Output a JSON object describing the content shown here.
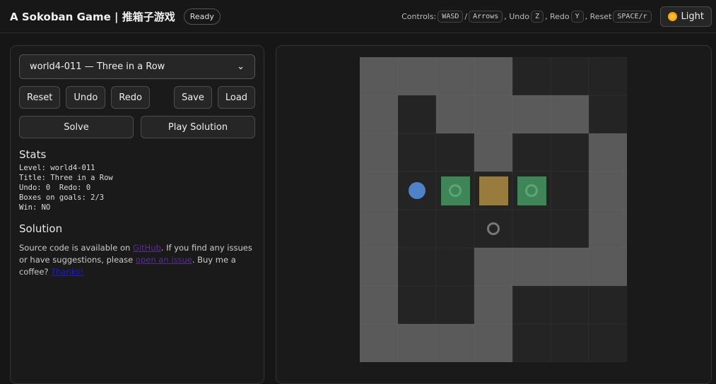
{
  "header": {
    "title": "A Sokoban Game | 推箱子游戏",
    "status": "Ready",
    "controls_label": "Controls:",
    "keys": {
      "move1": "WASD",
      "sep": "/",
      "move2": "Arrows",
      "undo_label": ", Undo",
      "undo": "Z",
      "redo_label": ", Redo",
      "redo": "Y",
      "reset_label": ", Reset",
      "reset": "SPACE/r"
    },
    "theme_button": "Light"
  },
  "sidebar": {
    "level_select": "world4-011 — Three in a Row",
    "buttons": {
      "reset": "Reset",
      "undo": "Undo",
      "redo": "Redo",
      "save": "Save",
      "load": "Load",
      "solve": "Solve",
      "play_solution": "Play Solution"
    },
    "stats_heading": "Stats",
    "stats": [
      "Level: world4-011",
      "Title: Three in a Row",
      "Undo: 0  Redo: 0",
      "Boxes on goals: 2/3",
      "Win: NO"
    ],
    "solution_heading": "Solution",
    "about": {
      "t1": "Source code is available on ",
      "github": "GitHub",
      "t2": ". If you find any issues or have suggestions, please ",
      "issue": "open an issue",
      "t3": ". Buy me a coffee? ",
      "thanks": "Thanks!"
    }
  },
  "board": {
    "legend": {
      "#": "wall",
      " ": "floor",
      "_": "outside",
      "@": "player",
      "*": "box-on-goal",
      "$": "box",
      ".": "goal"
    },
    "map": [
      "####___",
      "# ####",
      "#  #  #",
      "#@*$* #",
      "#  .  #",
      "#  ####",
      "#  #___",
      "####___"
    ]
  },
  "colors": {
    "wall": "#5a5a5a",
    "floor": "#242424",
    "box": "#9a7b3e",
    "box_on_goal": "#3f8558",
    "player": "#4f82c8"
  }
}
